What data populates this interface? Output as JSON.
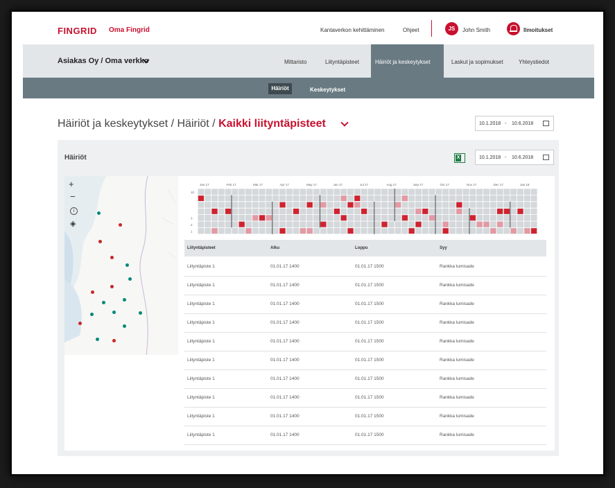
{
  "header": {
    "logo": "FINGRID",
    "app_name": "Oma Fingrid",
    "links": [
      "Kantaverkon kehittäminen",
      "Ohjeet"
    ],
    "user_initials": "JS",
    "user_name": "John Smith",
    "notifications_label": "Ilmoitukset"
  },
  "nav": {
    "account": "Asiakas Oy / Oma verkko",
    "items": [
      "Mittaristo",
      "Liityntäpisteet",
      "Häiriöt ja keskeytykset",
      "Laskut ja sopimukset",
      "Yhteystiedot"
    ],
    "active_index": 2
  },
  "subnav": {
    "items": [
      "Häiriöt",
      "Keskeytykset"
    ],
    "active_index": 0
  },
  "page": {
    "breadcrumb_main": "Häiriöt ja keskeytykset / Häiriöt / ",
    "breadcrumb_current": "Kaikki liityntäpisteet",
    "date_from": "10.1.2018",
    "date_sep": "-",
    "date_to": "10.6.2018"
  },
  "panel": {
    "title": "Häiriöt",
    "date_from": "10.1.2018",
    "date_sep": "-",
    "date_to": "10.6.2018",
    "excel_label": "X"
  },
  "map": {
    "zoom_in": "+",
    "zoom_out": "−",
    "info": "i",
    "layers": "◈"
  },
  "timeline": {
    "months": [
      "Jan 17",
      "Feb 17",
      "Mar 17",
      "Apr 17",
      "May 17",
      "Jun 17",
      "Jul 17",
      "Aug 17",
      "Sep 17",
      "Oct 17",
      "Nov 17",
      "Dec 17",
      "Jan 18"
    ],
    "row_labels": [
      "10",
      "",
      "",
      "",
      "3",
      "2",
      "1"
    ]
  },
  "table": {
    "columns": [
      "Liityntäpisteet",
      "Alku",
      "Loppu",
      "Syy"
    ],
    "rows": [
      [
        "Liityntäpiste 1",
        "01.01.17 1400",
        "01.01.17 1500",
        "Rankka lumisade"
      ],
      [
        "Liityntäpiste 1",
        "01.01.17 1400",
        "01.01.17 1500",
        "Rankka lumisade"
      ],
      [
        "Liityntäpiste 1",
        "01.01.17 1400",
        "01.01.17 1500",
        "Rankka lumisade"
      ],
      [
        "Liityntäpiste 1",
        "01.01.17 1400",
        "01.01.17 1500",
        "Rankka lumisade"
      ],
      [
        "Liityntäpiste 1",
        "01.01.17 1400",
        "01.01.17 1500",
        "Rankka lumisade"
      ],
      [
        "Liityntäpiste 1",
        "01.01.17 1400",
        "01.01.17 1500",
        "Rankka lumisade"
      ],
      [
        "Liityntäpiste 1",
        "01.01.17 1400",
        "01.01.17 1500",
        "Rankka lumisade"
      ],
      [
        "Liityntäpiste 1",
        "01.01.17 1400",
        "01.01.17 1500",
        "Rankka lumisade"
      ],
      [
        "Liityntäpiste 1",
        "01.01.17 1400",
        "01.01.17 1500",
        "Rankka lumisade"
      ],
      [
        "Liityntäpiste 1",
        "01.01.17 1400",
        "01.01.17 1500",
        "Rankka lumisade"
      ]
    ]
  },
  "colors": {
    "brand_red": "#c8102e",
    "nav_gray": "#697a83",
    "marker_red": "#c62828",
    "marker_teal": "#00897b"
  }
}
